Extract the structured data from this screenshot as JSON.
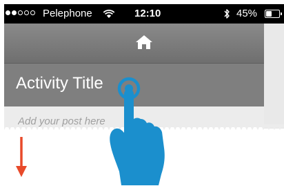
{
  "status_bar": {
    "signal_bars_filled": 2,
    "signal_bars_total": 5,
    "carrier": "Pelephone",
    "wifi_icon": "wifi-icon",
    "time": "12:10",
    "bluetooth_icon": "bluetooth-icon",
    "battery_percent": "45%",
    "battery_level": 0.45
  },
  "nav_bar": {
    "home_icon": "home-icon"
  },
  "activity": {
    "title": "Activity Title"
  },
  "post": {
    "placeholder": "Add your post here"
  },
  "gesture": {
    "hand_icon": "tap-hand-icon",
    "arrow_icon": "down-arrow-icon",
    "hand_color": "#1b8fcd",
    "arrow_color": "#e84a2a"
  }
}
